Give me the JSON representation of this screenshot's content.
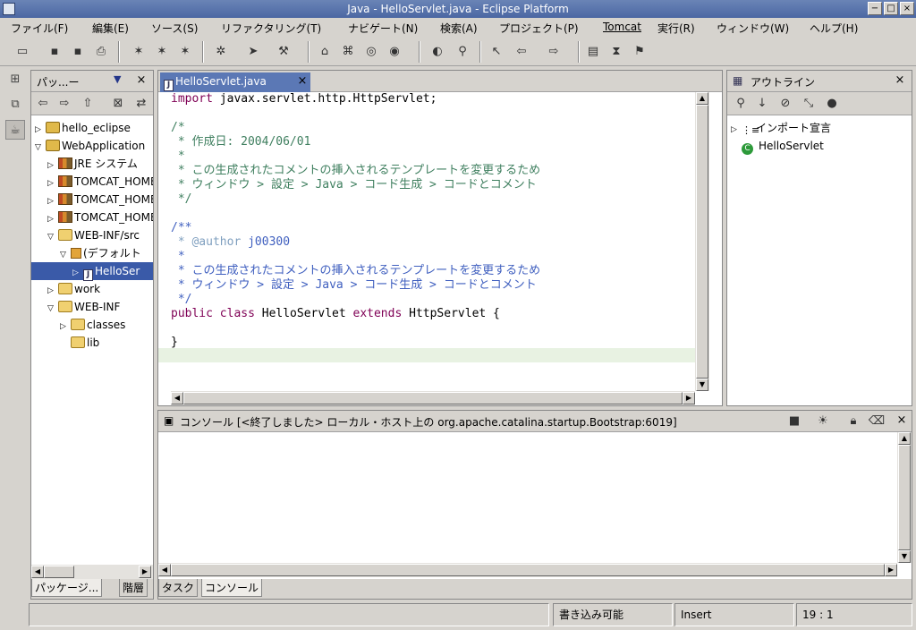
{
  "window": {
    "title": "Java - HelloServlet.java - Eclipse Platform",
    "buttons": {
      "minimize": "−",
      "maximize": "□",
      "close": "×"
    }
  },
  "menu": [
    "ファイル(F)",
    "編集(E)",
    "ソース(S)",
    "リファクタリング(T)",
    "ナビゲート(N)",
    "検索(A)",
    "プロジェクト(P)",
    "Tomcat",
    "実行(R)",
    "ウィンドウ(W)",
    "ヘルプ(H)"
  ],
  "package_explorer": {
    "title": "パッ...ー",
    "tree": [
      {
        "label": "hello_eclipse",
        "twisty": "▷",
        "icon": "project"
      },
      {
        "label": "WebApplication",
        "twisty": "▽",
        "icon": "project"
      },
      {
        "label": "JRE システム",
        "twisty": "▷",
        "icon": "library"
      },
      {
        "label": "TOMCAT_HOME/c",
        "twisty": "▷",
        "icon": "library"
      },
      {
        "label": "TOMCAT_HOME/c",
        "twisty": "▷",
        "icon": "library"
      },
      {
        "label": "TOMCAT_HOME/c",
        "twisty": "▷",
        "icon": "library"
      },
      {
        "label": "WEB-INF/src",
        "twisty": "▽",
        "icon": "folder"
      },
      {
        "label": "(デフォルト",
        "twisty": "▽",
        "icon": "package"
      },
      {
        "label": "HelloSer",
        "twisty": "▷",
        "icon": "java-file"
      },
      {
        "label": "work",
        "twisty": "▷",
        "icon": "folder"
      },
      {
        "label": "WEB-INF",
        "twisty": "▽",
        "icon": "folder"
      },
      {
        "label": "classes",
        "twisty": "▷",
        "icon": "folder"
      },
      {
        "label": "lib",
        "twisty": "",
        "icon": "folder"
      }
    ],
    "tabs": [
      "パッケージ...",
      "階層"
    ]
  },
  "editor": {
    "tab_label": "HelloServlet.java",
    "lines": {
      "l1_kw": "import",
      "l1_rest": " javax.servlet.http.HttpServlet;",
      "l3": "/*",
      "l4": " * 作成日: 2004/06/01",
      "l5": " *",
      "l6": " * この生成されたコメントの挿入されるテンプレートを変更するため",
      "l7": " * ウィンドウ > 設定 > Java > コード生成 > コードとコメント",
      "l8": " */",
      "l10": "/**",
      "l11_tag": " * @author",
      "l11_rest": " j00300",
      "l12": " *",
      "l13": " * この生成されたコメントの挿入されるテンプレートを変更するため",
      "l14": " * ウィンドウ > 設定 > Java > コード生成 > コードとコメント",
      "l15": " */",
      "l16_kw1": "public class",
      "l16_mid": " HelloServlet ",
      "l16_kw2": "extends",
      "l16_rest": " HttpServlet {",
      "l18": "}"
    }
  },
  "outline": {
    "title": "アウトライン",
    "items": [
      {
        "label": "インポート宣言",
        "twisty": "▷"
      },
      {
        "label": "HelloServlet",
        "twisty": ""
      }
    ]
  },
  "console": {
    "title": "コンソール [<終了しました> ローカル・ホスト上の org.apache.catalina.startup.Bootstrap:6019]",
    "tabs": [
      "タスク",
      "コンソール"
    ]
  },
  "status": {
    "writable": "書き込み可能",
    "mode": "Insert",
    "position": "19 : 1"
  },
  "colors": {
    "keyword": "#7f0055",
    "comment": "#3f7f5f",
    "javadoc": "#3f5fbf",
    "selection": "#3a5aa8",
    "current_line": "#e8f2e2"
  }
}
